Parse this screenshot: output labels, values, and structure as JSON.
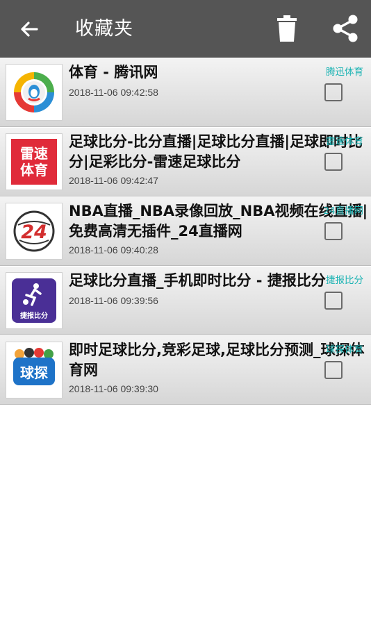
{
  "appbar": {
    "title": "收藏夹",
    "back_icon": "arrow-left-icon",
    "delete_icon": "trash-icon",
    "share_icon": "share-icon"
  },
  "colors": {
    "appbar_bg": "#555555",
    "source_text": "#1bb3b3",
    "row_gradient_top": "#f3f3f3",
    "row_gradient_bottom": "#d6d6d6"
  },
  "favorites": [
    {
      "title": "体育 - 腾讯网",
      "time": "2018-11-06 09:42:58",
      "source": "腾迅体育",
      "icon": "tencent-qq-logo",
      "checked": false
    },
    {
      "title": "足球比分-比分直播|足球比分直播|足球即时比分|足彩比分-雷速足球比分",
      "time": "2018-11-06 09:42:47",
      "source": "雷速体育",
      "icon": "leisu-sports-logo",
      "logo_text_top": "雷速",
      "logo_text_bottom": "体育",
      "checked": false
    },
    {
      "title": "NBA直播_NBA录像回放_NBA视频在线直播|免费高清无插件_24直播网",
      "time": "2018-11-06 09:40:28",
      "source": "24直播网",
      "icon": "24-live-logo",
      "logo_text": "24",
      "checked": false
    },
    {
      "title": "足球比分直播_手机即时比分 - 捷报比分",
      "time": "2018-11-06 09:39:56",
      "source": "捷报比分",
      "icon": "jiebao-score-logo",
      "logo_text": "捷报比分",
      "checked": false
    },
    {
      "title": "即时足球比分,竞彩足球,足球比分预测_球探体育网",
      "time": "2018-11-06 09:39:30",
      "source": "球探体育",
      "icon": "qiutan-sports-logo",
      "logo_text": "球探",
      "checked": false
    }
  ]
}
